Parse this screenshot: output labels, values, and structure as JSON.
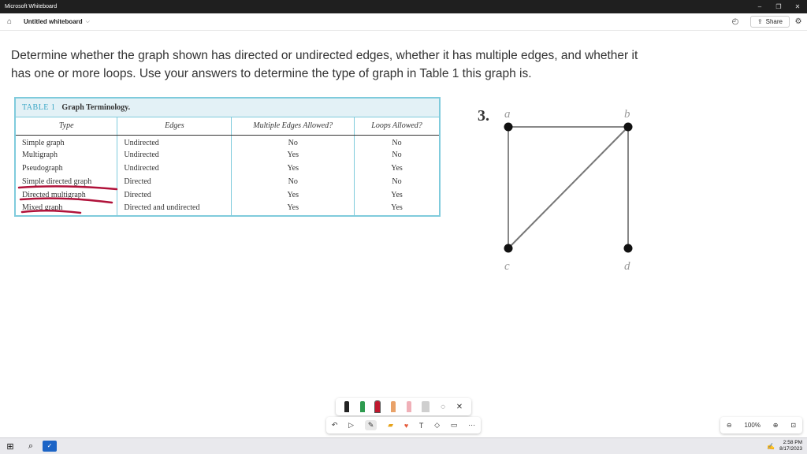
{
  "window": {
    "title": "Microsoft Whiteboard",
    "controls": [
      "–",
      "❐",
      "✕"
    ]
  },
  "appbar": {
    "board_name": "Untitled whiteboard",
    "share_label": "Share"
  },
  "question": {
    "text": "Determine whether the graph shown has directed or undirected edges, whether it has multiple edges, and whether it has one or more loops. Use your answers to determine the type of graph in Table 1 this graph is."
  },
  "table": {
    "number": "TABLE 1",
    "name": "Graph Terminology.",
    "headers": [
      "Type",
      "Edges",
      "Multiple Edges Allowed?",
      "Loops Allowed?"
    ],
    "rows": [
      [
        "Simple graph",
        "Undirected",
        "No",
        "No"
      ],
      [
        "Multigraph",
        "Undirected",
        "Yes",
        "No"
      ],
      [
        "Pseudograph",
        "Undirected",
        "Yes",
        "Yes"
      ],
      [
        "Simple directed graph",
        "Directed",
        "No",
        "No"
      ],
      [
        "Directed multigraph",
        "Directed",
        "Yes",
        "Yes"
      ],
      [
        "Mixed graph",
        "Directed and undirected",
        "Yes",
        "Yes"
      ]
    ],
    "strike_color": "#b0123a"
  },
  "graph": {
    "problem_number": "3.",
    "vertices": [
      "a",
      "b",
      "c",
      "d"
    ],
    "edges": [
      [
        "a",
        "b"
      ],
      [
        "a",
        "c"
      ],
      [
        "b",
        "c"
      ],
      [
        "b",
        "d"
      ]
    ]
  },
  "toolbox": {
    "pen_colors": [
      "#222222",
      "#2e9b4f",
      "#c0182e",
      "#e07a2a"
    ],
    "icons": [
      "pen-black-icon",
      "pen-green-icon",
      "pen-red-icon",
      "highlighter-icon",
      "eraser-icon",
      "ruler-icon",
      "lasso-icon",
      "close-icon"
    ]
  },
  "bottombar": {
    "icons": [
      "undo-icon",
      "select-icon",
      "inking-icon",
      "note-icon",
      "reaction-icon",
      "text-icon",
      "shapes-icon",
      "template-icon",
      "more-icon"
    ]
  },
  "zoom": {
    "level": "100%"
  },
  "taskbar": {
    "time": "2:58 PM",
    "date": "8/17/2023"
  }
}
